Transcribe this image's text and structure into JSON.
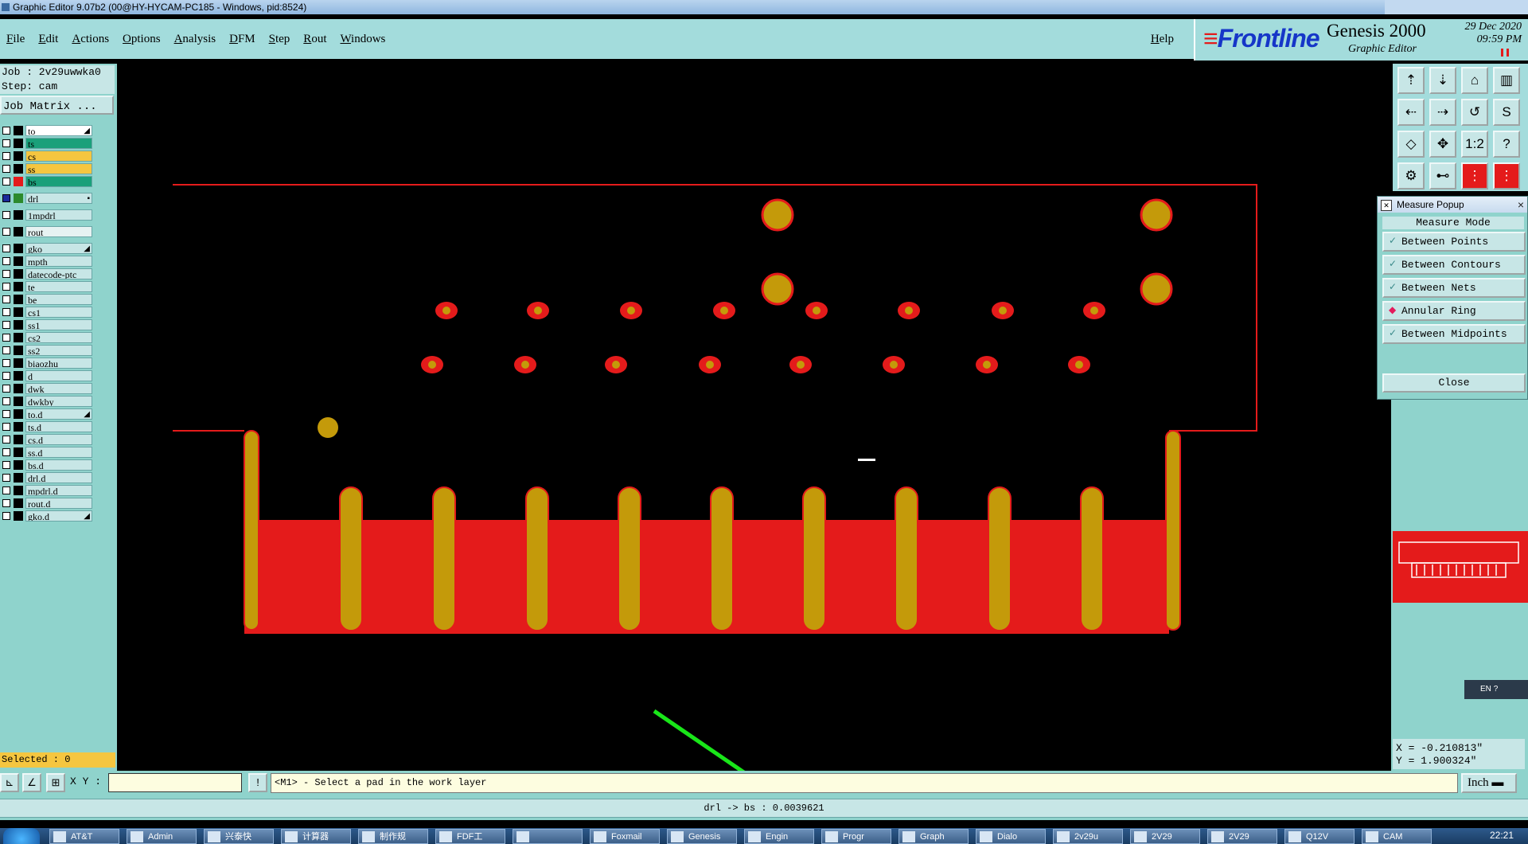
{
  "window": {
    "title": "Graphic Editor 9.07b2 (00@HY-HYCAM-PC185 - Windows, pid:8524)"
  },
  "menu": {
    "items": [
      "File",
      "Edit",
      "Actions",
      "Options",
      "Analysis",
      "DFM",
      "Step",
      "Rout",
      "Windows"
    ],
    "help": "Help"
  },
  "brand": {
    "logo": "Frontline",
    "product": "Genesis 2000",
    "subtitle": "Graphic Editor",
    "date": "29 Dec 2020",
    "time": "09:59 PM"
  },
  "left_panel": {
    "job": "Job : 2v29uwwka0",
    "step": "Step: cam",
    "job_matrix": "Job Matrix ...",
    "selected": "Selected : 0",
    "layers": [
      {
        "name": "to",
        "color": "#ffffff",
        "swatch": "#000000",
        "arrow": true
      },
      {
        "name": "ts",
        "color": "#1aa07a",
        "swatch": "#000000"
      },
      {
        "name": "cs",
        "color": "#f5c640",
        "swatch": "#000000"
      },
      {
        "name": "ss",
        "color": "#f5c640",
        "swatch": "#000000"
      },
      {
        "name": "bs",
        "color": "#1aa07a",
        "swatch": "#e41b1b"
      },
      {
        "name": "drl",
        "color": "#c7e6e6",
        "swatch": "#2c8a2c",
        "work": true
      },
      {
        "name": "1mpdrl",
        "color": "#c7e6e6",
        "swatch": "#000000"
      },
      {
        "name": "rout",
        "color": "#e6f2f2",
        "swatch": "#000000"
      },
      {
        "name": "gko",
        "color": "#c7e6e6",
        "swatch": "#000000",
        "arrow": true
      },
      {
        "name": "mpth",
        "color": "#c7e6e6",
        "swatch": "#000000"
      },
      {
        "name": "datecode-ptc",
        "color": "#c7e6e6",
        "swatch": "#000000"
      },
      {
        "name": "te",
        "color": "#c7e6e6",
        "swatch": "#000000"
      },
      {
        "name": "be",
        "color": "#c7e6e6",
        "swatch": "#000000"
      },
      {
        "name": "cs1",
        "color": "#c7e6e6",
        "swatch": "#000000"
      },
      {
        "name": "ss1",
        "color": "#c7e6e6",
        "swatch": "#000000"
      },
      {
        "name": "cs2",
        "color": "#c7e6e6",
        "swatch": "#000000"
      },
      {
        "name": "ss2",
        "color": "#c7e6e6",
        "swatch": "#000000"
      },
      {
        "name": "biaozhu",
        "color": "#c7e6e6",
        "swatch": "#000000"
      },
      {
        "name": "d",
        "color": "#c7e6e6",
        "swatch": "#000000"
      },
      {
        "name": "dwk",
        "color": "#c7e6e6",
        "swatch": "#000000"
      },
      {
        "name": "dwkby",
        "color": "#c7e6e6",
        "swatch": "#000000"
      },
      {
        "name": "to.d",
        "color": "#c7e6e6",
        "swatch": "#000000",
        "arrow": true
      },
      {
        "name": "ts.d",
        "color": "#c7e6e6",
        "swatch": "#000000"
      },
      {
        "name": "cs.d",
        "color": "#c7e6e6",
        "swatch": "#000000"
      },
      {
        "name": "ss.d",
        "color": "#c7e6e6",
        "swatch": "#000000"
      },
      {
        "name": "bs.d",
        "color": "#c7e6e6",
        "swatch": "#000000"
      },
      {
        "name": "drl.d",
        "color": "#c7e6e6",
        "swatch": "#000000"
      },
      {
        "name": "mpdrl.d",
        "color": "#c7e6e6",
        "swatch": "#000000"
      },
      {
        "name": "rout.d",
        "color": "#c7e6e6",
        "swatch": "#000000"
      },
      {
        "name": "gko.d",
        "color": "#c7e6e6",
        "swatch": "#000000",
        "arrow": true
      }
    ]
  },
  "toolbar_icons": [
    "pan-up-icon",
    "pan-down-icon",
    "home-icon",
    "window-icon",
    "pan-left-icon",
    "pan-right-icon",
    "zoom-back-icon",
    "redraw-icon",
    "fit-all-icon",
    "fit-window-icon",
    "scale-1-2-icon",
    "help-icon",
    "snap-icon",
    "measure-icon",
    "net-icon",
    "highlight-icon"
  ],
  "toolbar_glyphs": [
    "⇡",
    "⇣",
    "⌂",
    "▥",
    "⇠",
    "⇢",
    "↺",
    "S",
    "◇",
    "✥",
    "1:2",
    "?",
    "⚙",
    "⊷",
    "⋮",
    "⋮"
  ],
  "measure_popup": {
    "title": "Measure Popup",
    "mode_label": "Measure Mode",
    "options": [
      "Between Points",
      "Between Contours",
      "Between Nets",
      "Annular Ring",
      "Between Midpoints"
    ],
    "active_index": 3,
    "close_label": "Close"
  },
  "right_panel": {
    "x": "X = -0.210813\"",
    "y": "Y = 1.900324\"",
    "lang": "EN"
  },
  "command": {
    "xy_label": "X Y :",
    "xy_value": "",
    "prompt": "<M1> - Select a pad in the work layer",
    "units": "Inch"
  },
  "status": {
    "text": "drl -> bs : 0.0039621"
  },
  "taskbar": {
    "items": [
      "AT&T",
      "Admin",
      "兴泰快",
      "计算器",
      "制作规",
      "FDF工",
      "",
      "Foxmail",
      "Genesis",
      "Engin",
      "Progr",
      "Graph",
      "Dialo",
      "2v29u",
      "2V29",
      "2V29",
      "Q12V",
      "CAM"
    ],
    "clock": "22:21"
  },
  "colors": {
    "panel": "#8fd3cc",
    "menu": "#a3dcdc",
    "copper": "#c49a0a",
    "mask": "#e41b1b",
    "annotation_arrow": "#19e619"
  }
}
